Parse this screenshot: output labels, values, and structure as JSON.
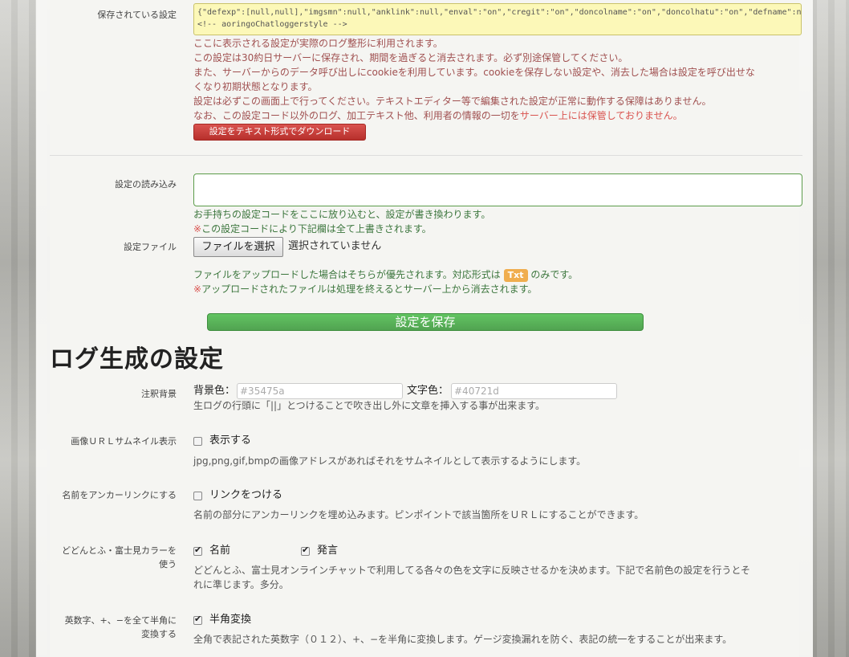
{
  "saved": {
    "label": "保存されている設定",
    "code_line1": "{\"defexp\":[null,null],\"imgsmn\":null,\"anklink\":null,\"enval\":\"on\",\"cregit\":\"on\",\"doncolname\":\"on\",\"doncolhatu\":\"on\",\"defname\":nu",
    "code_line2": "<!-- aoringoChatloggerstyle -->",
    "note1": "ここに表示される設定が実際のログ整形に利用されます。",
    "note2": "この設定は30約日サーバーに保存され、期間を過ぎると消去されます。必ず別途保管してください。",
    "note3": "また、サーバーからのデータ呼び出しにcookieを利用しています。cookieを保存しない設定や、消去した場合は設定を呼び出せな",
    "note4": "くなり初期状態となります。",
    "note5": "設定は必ずこの画面上で行ってください。テキストエディター等で編集された設定が正常に動作する保障はありません。",
    "note6a": "なお、この設定コード以外のログ、加工テキスト他、利用者の情報の一切を",
    "note6b": "サーバー上には保管しておりません。",
    "download_button": "設定をテキスト形式でダウンロード"
  },
  "load": {
    "label": "設定の読み込み",
    "hint1": "お手持ちの設定コードをここに放り込むと、設定が書き換わります。",
    "hint2_mark": "※",
    "hint2": "この設定コードにより下記欄は全て上書きされます。"
  },
  "file": {
    "label": "設定ファイル",
    "button": "ファイルを選択",
    "status": "選択されていません",
    "hint1a": "ファイルをアップロードした場合はそちらが優先されます。対応形式は",
    "badge": "Txt",
    "hint1b": "のみです。",
    "hint2_mark": "※",
    "hint2": "アップロードされたファイルは処理を終えるとサーバー上から消去されます。"
  },
  "save_button": "設定を保存",
  "log_section": {
    "title": "ログ生成の設定",
    "annotation_bg": {
      "label": "注釈背景",
      "bg_label": "背景色：",
      "bg_placeholder": "#35475a",
      "fg_label": "文字色：",
      "fg_placeholder": "#40721d",
      "hint": "生ログの行頭に「||」とつけることで吹き出し外に文章を挿入する事が出来ます。"
    },
    "thumbnail": {
      "label": "画像ＵＲＬサムネイル表示",
      "checkbox": "表示する",
      "checked": false,
      "hint": "jpg,png,gif,bmpの画像アドレスがあればそれをサムネイルとして表示するようにします。"
    },
    "anchor": {
      "label": "名前をアンカーリンクにする",
      "checkbox": "リンクをつける",
      "checked": false,
      "hint": "名前の部分にアンカーリンクを埋め込みます。ピンポイントで該当箇所をＵＲＬにすることができます。"
    },
    "dodontof": {
      "label_line1": "どどんとふ・富士見カラーを",
      "label_line2": "使う",
      "checkbox_name": "名前",
      "checkbox_speech": "発言",
      "name_checked": true,
      "speech_checked": true,
      "hint1": "どどんとふ、富士見オンラインチャットで利用してる各々の色を文字に反映させるかを決めます。下記で名前色の設定を行うとそ",
      "hint2": "れに準じます。多分。"
    },
    "halfwidth": {
      "label_line1": "英数字、+、−を全て半角に",
      "label_line2": "変換する",
      "checkbox": "半角変換",
      "checked": true,
      "hint": "全角で表記された英数字（０１２）、+、−を半角に変換します。ゲージ変換漏れを防ぐ、表記の統一をすることが出来ます。"
    }
  }
}
